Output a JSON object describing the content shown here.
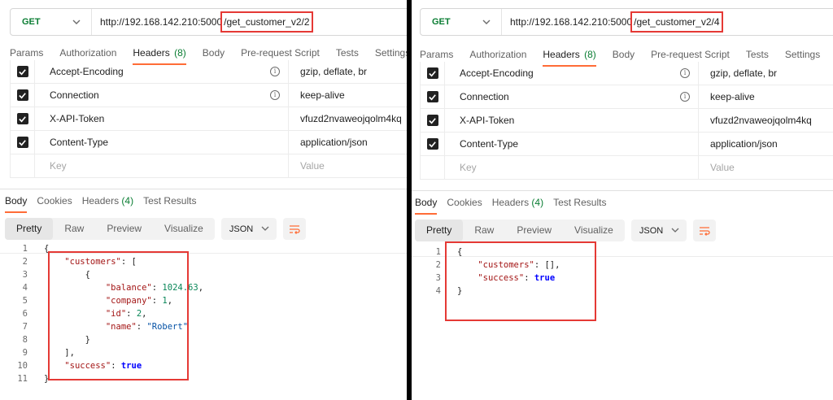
{
  "panels": [
    {
      "method": "GET",
      "url_base": "http://192.168.142.210:5000",
      "url_path": "/get_customer_v2/2",
      "request_tabs": [
        {
          "label": "Params"
        },
        {
          "label": "Authorization"
        },
        {
          "label": "Headers",
          "count": "(8)"
        },
        {
          "label": "Body"
        },
        {
          "label": "Pre-request Script"
        },
        {
          "label": "Tests"
        },
        {
          "label": "Settings"
        }
      ],
      "headers": [
        {
          "key": "Accept-Encoding",
          "value": "gzip, deflate, br"
        },
        {
          "key": "Connection",
          "value": "keep-alive"
        },
        {
          "key": "X-API-Token",
          "value": "vfuzd2nvaweojqolm4kq"
        },
        {
          "key": "Content-Type",
          "value": "application/json"
        }
      ],
      "key_placeholder": "Key",
      "value_placeholder": "Value",
      "response_tabs": [
        {
          "label": "Body"
        },
        {
          "label": "Cookies"
        },
        {
          "label": "Headers",
          "count": "(4)"
        },
        {
          "label": "Test Results"
        }
      ],
      "view_modes": [
        "Pretty",
        "Raw",
        "Preview",
        "Visualize"
      ],
      "format": "JSON",
      "line_numbers": [
        "1",
        "2",
        "3",
        "4",
        "5",
        "6",
        "7",
        "8",
        "9",
        "10",
        "11"
      ],
      "code": {
        "key_customers": "\"customers\"",
        "key_balance": "\"balance\"",
        "val_balance": "1024.63",
        "key_company": "\"company\"",
        "val_company": "1",
        "key_id": "\"id\"",
        "val_id": "2",
        "key_name": "\"name\"",
        "val_name": "\"Robert\"",
        "key_success": "\"success\"",
        "val_success": "true"
      }
    },
    {
      "method": "GET",
      "url_base": "http://192.168.142.210:5000",
      "url_path": "/get_customer_v2/4",
      "request_tabs": [
        {
          "label": "Params"
        },
        {
          "label": "Authorization"
        },
        {
          "label": "Headers",
          "count": "(8)"
        },
        {
          "label": "Body"
        },
        {
          "label": "Pre-request Script"
        },
        {
          "label": "Tests"
        },
        {
          "label": "Settings"
        }
      ],
      "headers": [
        {
          "key": "Accept-Encoding",
          "value": "gzip, deflate, br"
        },
        {
          "key": "Connection",
          "value": "keep-alive"
        },
        {
          "key": "X-API-Token",
          "value": "vfuzd2nvaweojqolm4kq"
        },
        {
          "key": "Content-Type",
          "value": "application/json"
        }
      ],
      "key_placeholder": "Key",
      "value_placeholder": "Value",
      "response_tabs": [
        {
          "label": "Body"
        },
        {
          "label": "Cookies"
        },
        {
          "label": "Headers",
          "count": "(4)"
        },
        {
          "label": "Test Results"
        }
      ],
      "view_modes": [
        "Pretty",
        "Raw",
        "Preview",
        "Visualize"
      ],
      "format": "JSON",
      "line_numbers": [
        "1",
        "2",
        "3",
        "4"
      ],
      "code": {
        "key_customers": "\"customers\"",
        "key_success": "\"success\"",
        "val_success": "true"
      }
    }
  ],
  "colors": {
    "method_get": "#0a7d33",
    "active_tab_underline": "#ff6c37",
    "highlight_box": "#e53935",
    "json_key": "#a31515",
    "json_number": "#098658",
    "json_string": "#0451a5",
    "json_boolean": "#0000ff"
  },
  "icons": [
    "chevron-down-icon",
    "checkbox-checked-icon",
    "info-icon",
    "wrap-lines-icon"
  ]
}
